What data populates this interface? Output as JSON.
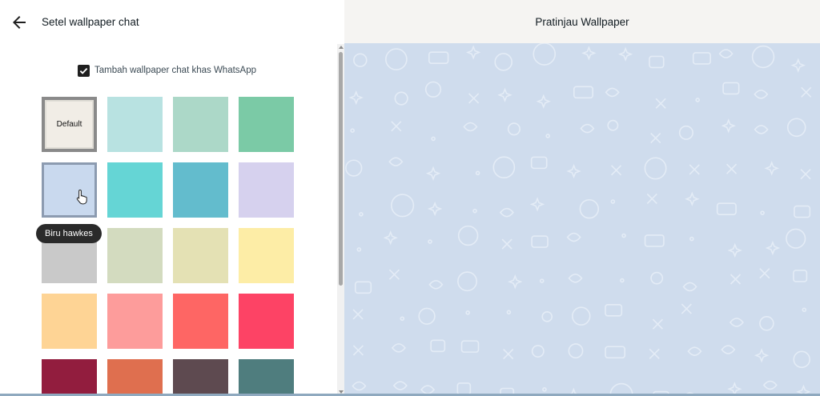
{
  "header": {
    "title": "Setel wallpaper chat",
    "back_icon": "arrow-left-icon"
  },
  "doodle_option": {
    "label": "Tambah wallpaper chat khas WhatsApp",
    "checked": true
  },
  "swatches": [
    {
      "name": "default",
      "label": "Default",
      "color": "#f1ede6"
    },
    {
      "color": "#b8e2e1"
    },
    {
      "color": "#acd8c8"
    },
    {
      "color": "#7bcaa6"
    },
    {
      "name": "biru-hawkes",
      "color": "#c9d9ee",
      "selected": true
    },
    {
      "color": "#65d5d5"
    },
    {
      "color": "#63bccd"
    },
    {
      "color": "#d6d1ee"
    },
    {
      "color": "#c9c9c9"
    },
    {
      "color": "#d3dbbf"
    },
    {
      "color": "#e4e1b4"
    },
    {
      "color": "#fdeda6"
    },
    {
      "color": "#fed495"
    },
    {
      "color": "#fd9c9b"
    },
    {
      "color": "#fe6664"
    },
    {
      "color": "#fd4365"
    },
    {
      "color": "#921d3e"
    },
    {
      "color": "#df6f4f"
    },
    {
      "color": "#5e4a50"
    },
    {
      "color": "#4f7d7e"
    }
  ],
  "tooltip": {
    "text": "Biru hawkes"
  },
  "preview": {
    "title": "Pratinjau Wallpaper",
    "background": "#cfdced"
  }
}
